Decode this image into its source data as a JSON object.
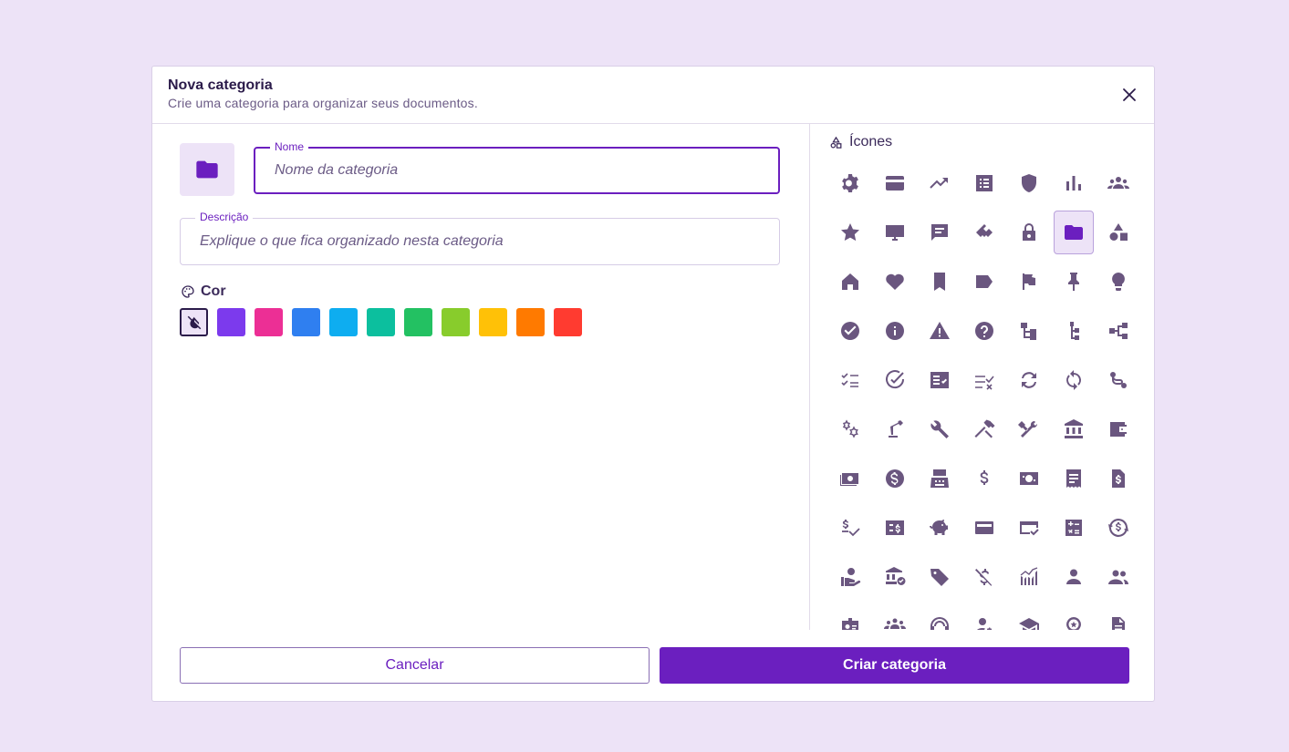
{
  "dialog": {
    "title": "Nova categoria",
    "subtitle": "Crie uma categoria para organizar seus documentos."
  },
  "form": {
    "name_label": "Nome",
    "name_placeholder": "Nome da categoria",
    "name_value": "",
    "description_label": "Descrição",
    "description_placeholder": "Explique o que fica organizado nesta categoria",
    "description_value": "",
    "color_label": "Cor",
    "colors": [
      "#7c3aed",
      "#ec2f95",
      "#2f7ff0",
      "#0eadf0",
      "#0cbf9e",
      "#23c162",
      "#88cc2c",
      "#ffc107",
      "#ff7a00",
      "#ff3b30"
    ],
    "selected_color": "none"
  },
  "icons": {
    "label": "Ícones",
    "selected": "folder-icon",
    "items": [
      "gear-icon",
      "credit-card-icon",
      "trending-up-icon",
      "list-icon",
      "shield-icon",
      "bar-chart-icon",
      "groups-icon",
      "star-icon",
      "monitor-icon",
      "chat-icon",
      "handshake-icon",
      "lock-icon",
      "folder-icon",
      "shapes-icon",
      "home-icon",
      "heart-icon",
      "bookmark-icon",
      "label-icon",
      "flag-icon",
      "pin-icon",
      "lightbulb-icon",
      "check-circle-icon",
      "info-icon",
      "warning-icon",
      "help-icon",
      "account-tree-icon",
      "tree-icon",
      "hub-icon",
      "checklist-icon",
      "task-alt-icon",
      "fact-check-icon",
      "rule-icon",
      "sync-icon",
      "loop-icon",
      "route-icon",
      "gears-icon",
      "precision-icon",
      "wrench-icon",
      "hammer-icon",
      "tools-icon",
      "bank-icon",
      "wallet-icon",
      "money-icon",
      "dollar-circle-icon",
      "cash-register-icon",
      "dollar-icon",
      "payments-icon",
      "receipt-icon",
      "invoice-icon",
      "price-check-icon",
      "dollar-box-icon",
      "piggy-bank-icon",
      "coin-wallet-icon",
      "card-check-icon",
      "calculator-icon",
      "currency-exchange-icon",
      "hand-coins-icon",
      "bank-check-icon",
      "tag-icon",
      "money-off-icon",
      "chart-line-icon",
      "person-icon",
      "people-icon",
      "badge-icon",
      "team-icon",
      "support-icon",
      "manage-accounts-icon",
      "school-icon",
      "award-icon",
      "document-icon"
    ]
  },
  "footer": {
    "cancel_label": "Cancelar",
    "create_label": "Criar categoria"
  },
  "theme": {
    "accent": "#6b1fbf",
    "icon_color": "#6a567f",
    "background": "#ede3f7"
  }
}
